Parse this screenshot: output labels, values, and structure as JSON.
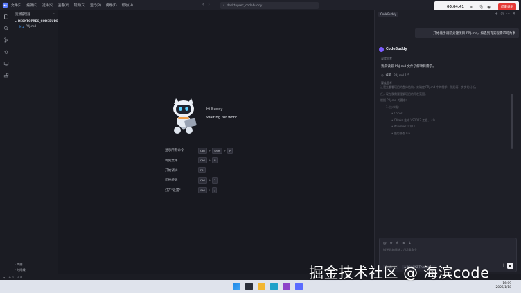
{
  "titlebar": {
    "menu": [
      "文件(F)",
      "编辑(E)",
      "选择(S)",
      "查看(V)",
      "转到(G)",
      "运行(R)",
      "终端(T)",
      "帮助(H)"
    ],
    "search": "desktoprec_codebuddy"
  },
  "recorder": {
    "timer": "00:04:41",
    "end_label": "结束录制"
  },
  "explorer": {
    "title": "资源管理器",
    "more": "···",
    "folder": "DESKTOPREC_CODEBUDDY",
    "files": [
      {
        "icon": "M↓",
        "name": "PRJ.md"
      }
    ],
    "outline": "大纲",
    "timeline": "时间线"
  },
  "welcome": {
    "buddy_name": "Hi Buddy",
    "status": "Waiting for work...",
    "shortcuts": [
      {
        "label": "显示所有命令",
        "keys": [
          "Ctrl",
          "Shift",
          "P"
        ]
      },
      {
        "label": "转到文件",
        "keys": [
          "Ctrl",
          "P"
        ]
      },
      {
        "label": "开始调试",
        "keys": [
          "F5"
        ]
      },
      {
        "label": "切换终端",
        "keys": [
          "Ctrl",
          "`"
        ]
      },
      {
        "label": "打开\"设置\"",
        "keys": [
          "Ctrl",
          ","
        ]
      }
    ]
  },
  "chat": {
    "tab": "CodeBuddy",
    "actions": [
      "+",
      "◷",
      "···",
      "✕"
    ],
    "user_message": "开始着手调研关键项目 PRJ.md，如遇到有实现需求可为事",
    "bot_name": "CodeBuddy",
    "plan_label": "深度思考",
    "plan_text": "我来读取 PRJ.md 文件了解项目需求。",
    "read_label": "读取",
    "read_file": "PRJ.md 1-5",
    "think_label": "深度思考",
    "think_lines": [
      "让我先看看项目的整体结构，来确定 PRJ.md 中的需求，然后再一步步的分析，",
      "任，现在我需要理解项目的开发范围。",
      "根据 PRJ.md 的要求：",
      "1. 技术栈：",
      "• Cocos",
      "• CMake 生成 VS2022 工程，.sln",
      "• Windows 10/11",
      "• 使用静态 lua"
    ],
    "input_tools": [
      "@",
      "⊕",
      "#",
      "⊞",
      "⇅"
    ],
    "input_placeholder": "描述你的需求，/ 切换命令",
    "mode": "Craft",
    "model": "Kimi-K2-Thinking"
  },
  "statusbar": {
    "items": [
      "⊗ 0",
      "⚠ 0"
    ]
  },
  "taskbar": {
    "time": "16:09",
    "date": "2026/1/18"
  },
  "watermark": "掘金技术社区 @ 海滨code"
}
